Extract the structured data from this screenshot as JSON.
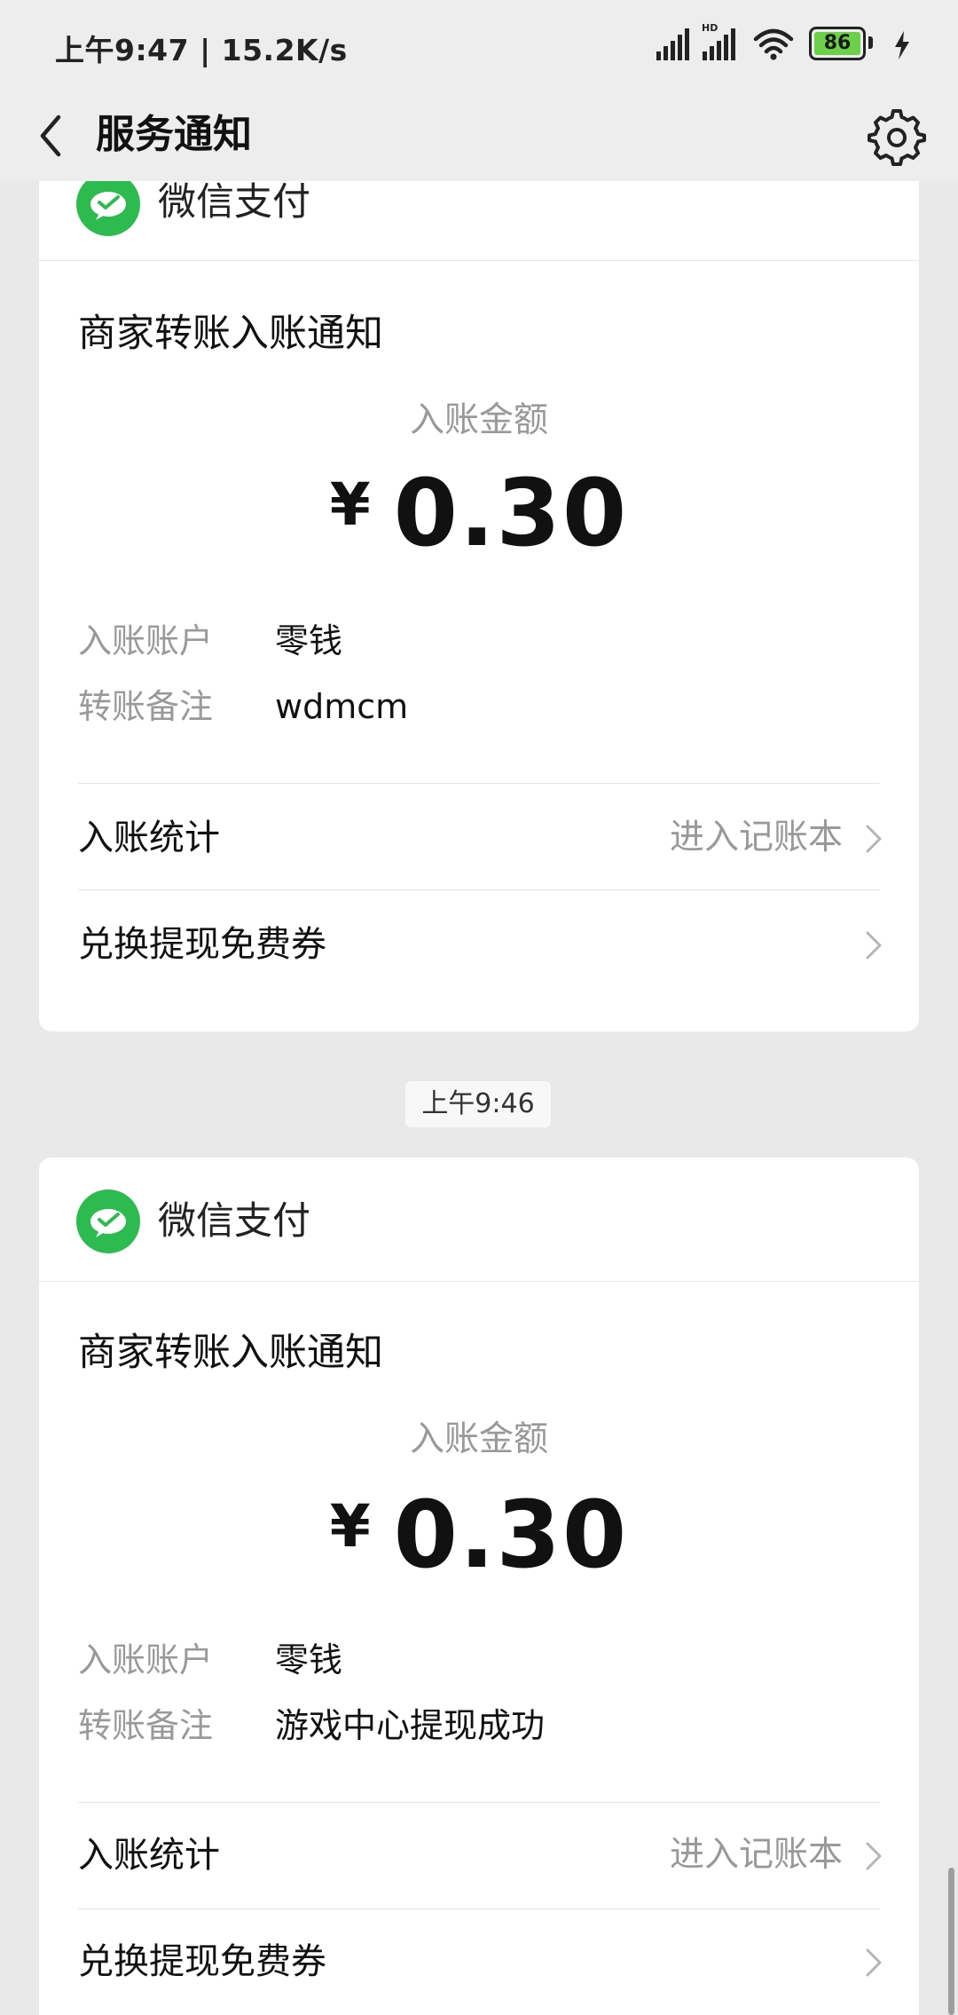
{
  "status_bar": {
    "time": "上午9:47 | 15.2K/s",
    "network_badge": "HD",
    "battery": "86",
    "icons": [
      "signal-icon",
      "hd-signal-icon",
      "wifi-icon",
      "battery-icon",
      "charging-icon"
    ]
  },
  "nav": {
    "title": "服务通知",
    "back_icon": "back-chevron-icon",
    "settings_icon": "gear-icon"
  },
  "colors": {
    "wechat_green": "#2dbb4f",
    "background": "#e9e9e9",
    "card": "#ffffff",
    "muted": "#999999"
  },
  "notifications": [
    {
      "brand": "微信支付",
      "title": "商家转账入账通知",
      "amount_label": "入账金额",
      "currency": "¥",
      "amount": "0.30",
      "account_label": "入账账户",
      "account_value": "零钱",
      "remark_label": "转账备注",
      "remark_value": "wdmcm",
      "stats_label": "入账统计",
      "stats_link": "进入记账本",
      "voucher_label": "兑换提现免费券"
    },
    {
      "brand": "微信支付",
      "title": "商家转账入账通知",
      "amount_label": "入账金额",
      "currency": "¥",
      "amount": "0.30",
      "account_label": "入账账户",
      "account_value": "零钱",
      "remark_label": "转账备注",
      "remark_value": "游戏中心提现成功",
      "stats_label": "入账统计",
      "stats_link": "进入记账本",
      "voucher_label": "兑换提现免费券"
    }
  ],
  "timestamp": "上午9:46"
}
